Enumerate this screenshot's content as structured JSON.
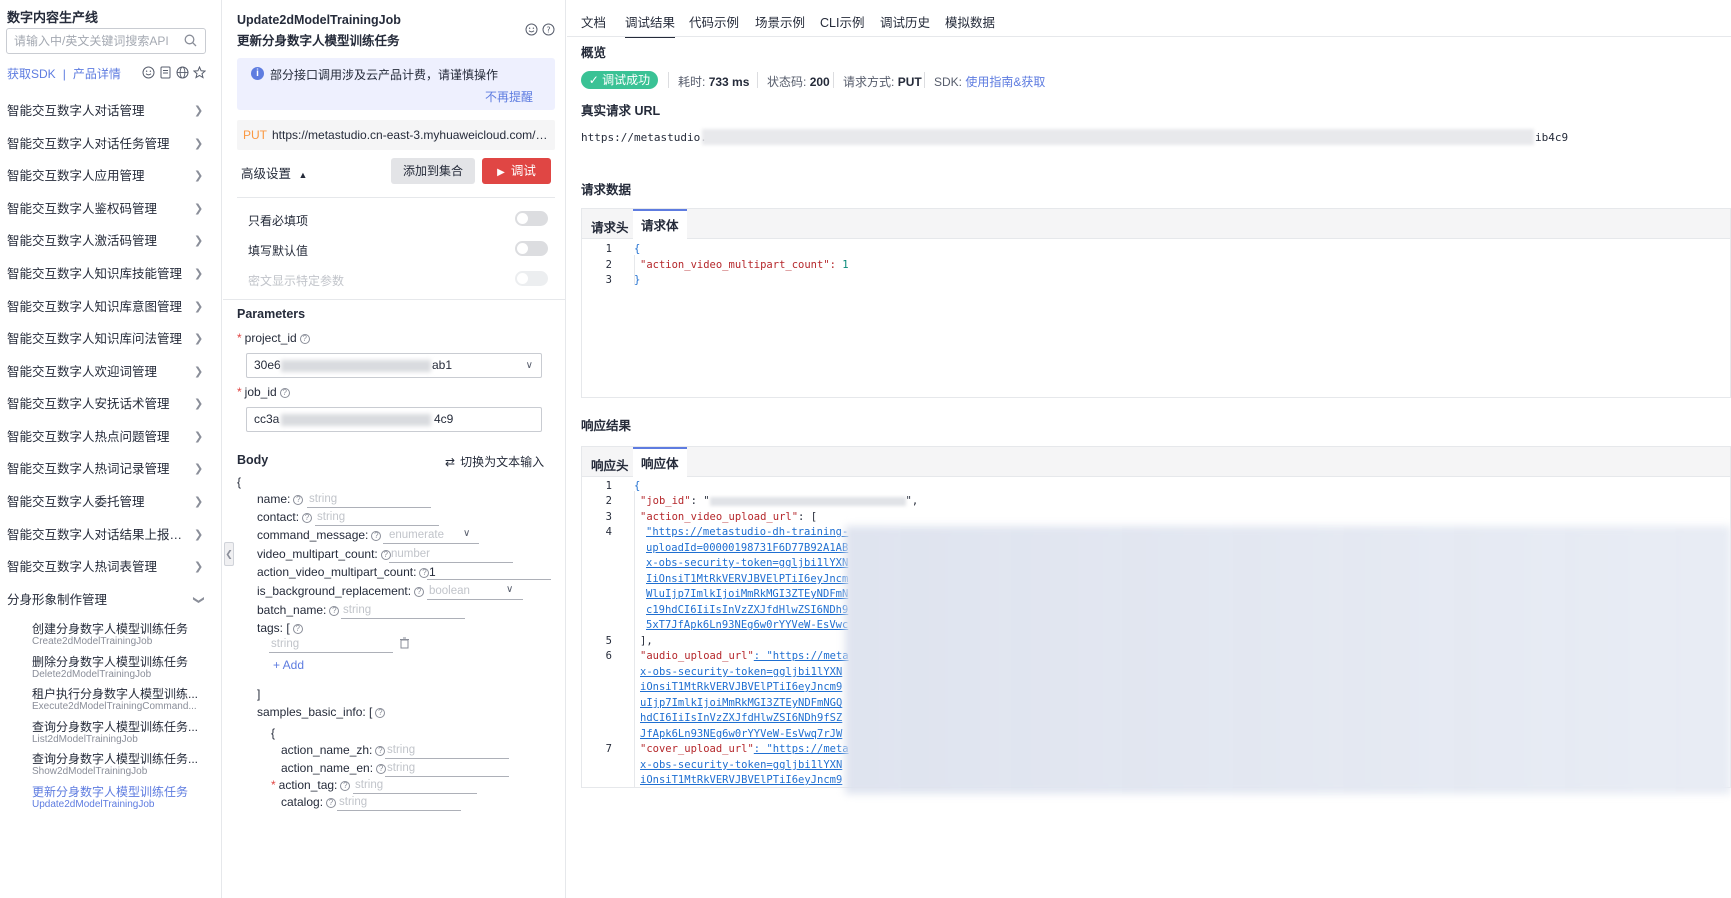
{
  "sidebar": {
    "title": "数字内容生产线",
    "search_placeholder": "请输入中/英文关键词搜索API",
    "sdk_link": "获取SDK",
    "sep": "|",
    "product_link": "产品详情",
    "menu": [
      "智能交互数字人对话管理",
      "智能交互数字人对话任务管理",
      "智能交互数字人应用管理",
      "智能交互数字人鉴权码管理",
      "智能交互数字人激活码管理",
      "智能交互数字人知识库技能管理",
      "智能交互数字人知识库意图管理",
      "智能交互数字人知识库问法管理",
      "智能交互数字人欢迎词管理",
      "智能交互数字人安抚话术管理",
      "智能交互数字人热点问题管理",
      "智能交互数字人热词记录管理",
      "智能交互数字人委托管理",
      "智能交互数字人对话结果上报配置...",
      "智能交互数字人热词表管理"
    ],
    "group": "分身形象制作管理",
    "sub_items": [
      {
        "zh": "创建分身数字人模型训练任务",
        "en": "Create2dModelTrainingJob"
      },
      {
        "zh": "删除分身数字人模型训练任务",
        "en": "Delete2dModelTrainingJob"
      },
      {
        "zh": "租户执行分身数字人模型训练...",
        "en": "Execute2dModelTrainingCommand..."
      },
      {
        "zh": "查询分身数字人模型训练任务...",
        "en": "List2dModelTrainingJob"
      },
      {
        "zh": "查询分身数字人模型训练任务...",
        "en": "Show2dModelTrainingJob"
      },
      {
        "zh": "更新分身数字人模型训练任务",
        "en": "Update2dModelTrainingJob"
      }
    ]
  },
  "middle": {
    "api_name": "Update2dModelTrainingJob",
    "api_title": "更新分身数字人模型训练任务",
    "notice": "部分接口调用涉及云产品计费，请谨慎操作",
    "dismiss": "不再提醒",
    "method": "PUT",
    "url": "https://metastudio.cn-east-3.myhuaweicloud.com/v1...",
    "advanced": "高级设置",
    "add_to_collection": "添加到集合",
    "debug": "调试",
    "toggles": [
      "只看必填项",
      "填写默认值",
      "密文显示特定参数"
    ],
    "parameters_title": "Parameters",
    "project_id_label": "project_id",
    "project_id_prefix": "30e6",
    "project_id_suffix": "ab1",
    "job_id_label": "job_id",
    "job_id_prefix": "cc3a",
    "job_id_suffix": "4c9",
    "body_title": "Body",
    "switch_text": "切换为文本输入",
    "open_brace": "{",
    "fields": {
      "name": "name:",
      "contact": "contact:",
      "command_message": "command_message:",
      "video_multipart_count": "video_multipart_count:",
      "action_video_multipart_count": "action_video_multipart_count:",
      "is_background_replacement": "is_background_replacement:",
      "batch_name": "batch_name:",
      "tags": "tags: [",
      "samples_basic_info": "samples_basic_info: [",
      "action_name_zh": "action_name_zh:",
      "action_name_en": "action_name_en:",
      "action_tag": "action_tag:",
      "catalog": "catalog:"
    },
    "ph_string": "string",
    "ph_enumerate": "enumerate",
    "ph_number": "number",
    "ph_boolean": "boolean",
    "amvc_value": "1",
    "add": "+ Add",
    "close_bracket": "]",
    "inner_open": "{"
  },
  "right": {
    "tabs": [
      "文档",
      "调试结果",
      "代码示例",
      "场景示例",
      "CLI示例",
      "调试历史",
      "模拟数据"
    ],
    "active_tab": 1,
    "overview": "概览",
    "success": "✓ 调试成功",
    "time_label": "耗时:",
    "time_value": "733 ms",
    "status_label": "状态码:",
    "status_value": "200",
    "method_label": "请求方式:",
    "method_value": "PUT",
    "sdk_label": "SDK:",
    "sdk_link": "使用指南&获取",
    "real_url_title": "真实请求 URL",
    "real_url_prefix": "https://metastudio.",
    "real_url_suffix": "ib4c9",
    "request_title": "请求数据",
    "req_tab_head": "请求头",
    "req_tab_body": "请求体",
    "req_lines": [
      "{",
      "\"action_video_multipart_count\": ",
      "1",
      "}"
    ],
    "response_title": "响应结果",
    "resp_tab_head": "响应头",
    "resp_tab_body": "响应体",
    "resp": {
      "l1": "{",
      "job_id_key": "\"job_id\"",
      "job_id_open": ": \"",
      "job_id_close": "\",",
      "avu_key": "\"action_video_upload_url\"",
      "avu_open": ": [",
      "link_lines": [
        "\"https://metastudio-dh-training-",
        "uploadId=00000198731F6D77B92A1AB",
        "x-obs-security-token=ggljbi1lYXN",
        "IiOnsiT1MtRkVERVJBVElPTiI6eyJncm",
        "WluIjp7ImlkIjoiMmRkMGI3ZTEyNDFmN",
        "c19hdCI6IiIsInVzZXJfdHlwZSI6NDh9",
        "5xT7JfApk6Ln93NEg6w0rYYVeW-EsVwc"
      ],
      "close_arr": "],",
      "audio_key": "\"audio_upload_url\"",
      "audio_open": ": \"https://meta",
      "audio_lines": [
        "x-obs-security-token=ggljbi1lYXN",
        "iOnsiT1MtRkVERVJBVElPTiI6eyJncm9",
        "uIjp7ImlkIjoiMmRkMGI3ZTEyNDFmNGQ",
        "hdCI6IiIsInVzZXJfdHlwZSI6NDh9fSZ",
        "JfApk6Ln93NEg6w0rYYVeW-EsVwq7rJW"
      ],
      "cover_key": "\"cover_upload_url\"",
      "cover_open": ": \"https://meta",
      "cover_lines": [
        "x-obs-security-token=ggljbi1lYXN",
        "iOnsiT1MtRkVERVJBVElPTiI6eyJncm9"
      ],
      "line_numbers": [
        "1",
        "2",
        "3",
        "4",
        "5",
        "6",
        "7"
      ]
    }
  },
  "colors": {
    "accent": "#5e7ce0",
    "danger": "#e04644",
    "success": "#3ac295",
    "method_put": "#fa9841"
  }
}
